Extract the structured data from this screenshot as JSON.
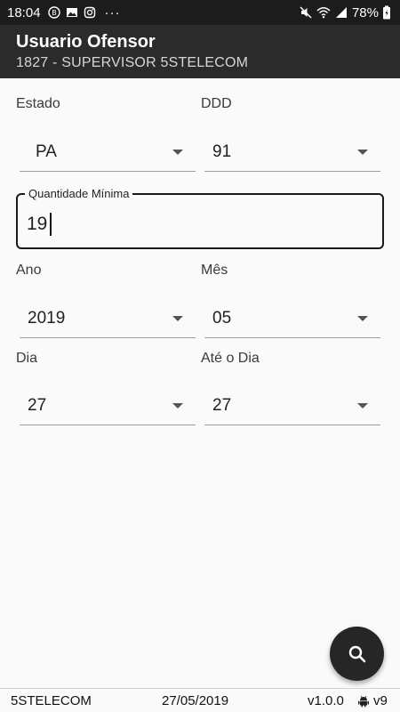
{
  "status_bar": {
    "time": "18:04",
    "more": "···",
    "battery": "78%",
    "left_icons": [
      "notification-app-icon",
      "image-icon",
      "instagram-icon"
    ],
    "right_icons": [
      "mute-icon",
      "wifi-icon",
      "signal-icon",
      "battery-icon"
    ]
  },
  "app_bar": {
    "title": "Usuario Ofensor",
    "subtitle": "1827 - SUPERVISOR  5STELECOM"
  },
  "form": {
    "estado": {
      "label": "Estado",
      "value": "PA"
    },
    "ddd": {
      "label": "DDD",
      "value": "91"
    },
    "quantidade": {
      "label": "Quantidade Mínima",
      "value": "19"
    },
    "ano": {
      "label": "Ano",
      "value": "2019"
    },
    "mes": {
      "label": "Mês",
      "value": "05"
    },
    "dia": {
      "label": "Dia",
      "value": "27"
    },
    "ate_dia": {
      "label": "Até o Dia",
      "value": "27"
    }
  },
  "fab": {
    "icon": "search-icon"
  },
  "footer": {
    "company": "5STELECOM",
    "date": "27/05/2019",
    "version": "v1.0.0",
    "os_icon": "android-icon",
    "api": "v9"
  }
}
